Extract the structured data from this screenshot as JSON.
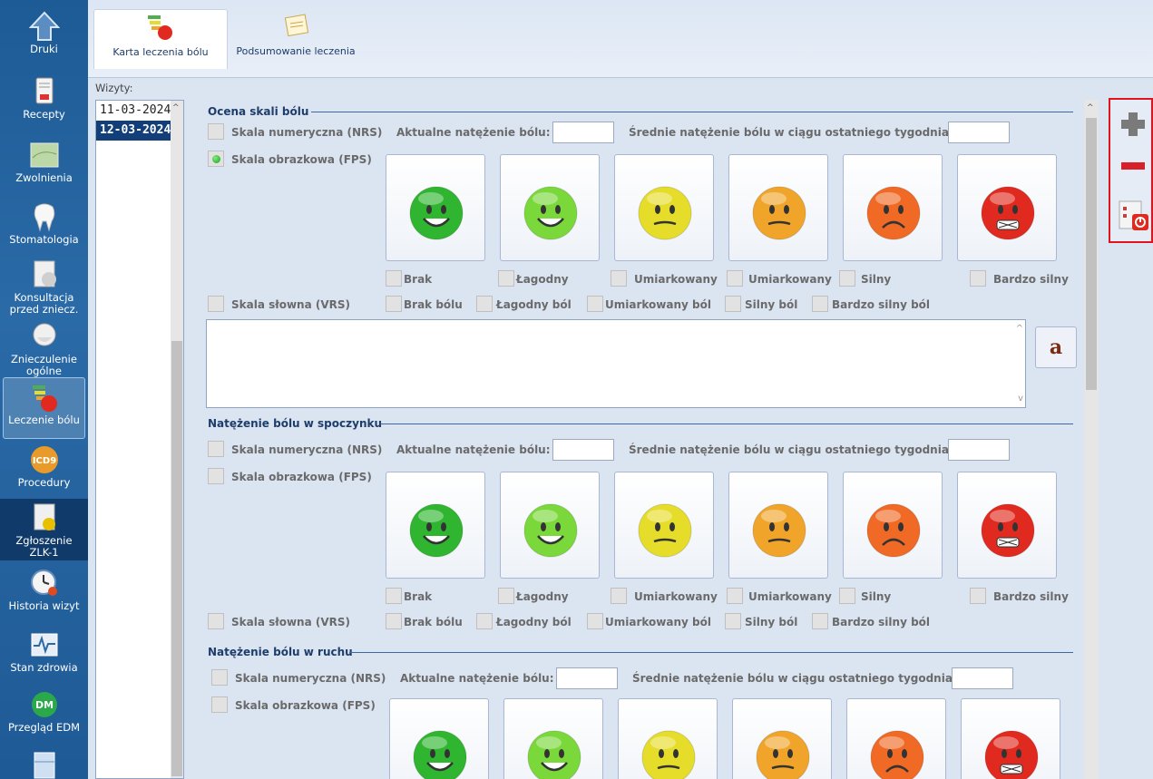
{
  "sidebar": {
    "items": [
      {
        "label": "Druki",
        "icon": "up-arrow-icon"
      },
      {
        "label": "Recepty",
        "icon": "prescription-icon"
      },
      {
        "label": "Zwolnienia",
        "icon": "map-icon"
      },
      {
        "label": "Stomatologia",
        "icon": "tooth-icon"
      },
      {
        "label": "Konsultacja przed zniecz.",
        "icon": "consultation-icon"
      },
      {
        "label": "Znieczulenie ogólne",
        "icon": "anesthesia-mask-icon"
      },
      {
        "label": "Leczenie bólu",
        "icon": "pain-scale-icon"
      },
      {
        "label": "Procedury",
        "icon": "icd9-icon"
      },
      {
        "label": "Zgłoszenie ZLK-1",
        "icon": "biohazard-report-icon"
      },
      {
        "label": "Historia wizyt",
        "icon": "clock-history-icon"
      },
      {
        "label": "Stan zdrowia",
        "icon": "health-chart-icon"
      },
      {
        "label": "Przegląd EDM",
        "icon": "edm-icon"
      }
    ]
  },
  "tabs": [
    {
      "label": "Karta leczenia bólu",
      "icon": "pain-scale-icon"
    },
    {
      "label": "Podsumowanie leczenia",
      "icon": "notes-icon"
    }
  ],
  "wizyty": {
    "label": "Wizyty:",
    "dates": [
      "11-03-2024",
      "12-03-2024"
    ]
  },
  "sections": [
    {
      "title": "Ocena skali bólu",
      "nrs": "Skala numeryczna (NRS)",
      "current": "Aktualne natężenie bólu:",
      "average": "Średnie natężenie bólu w ciągu ostatniego tygodnia:",
      "fps": "Skala obrazkowa (FPS)",
      "vrs": "Skala słowna (VRS)"
    },
    {
      "title": "Natężenie bólu w spoczynku",
      "nrs": "Skala numeryczna (NRS)",
      "current": "Aktualne natężenie bólu:",
      "average": "Średnie natężenie bólu w ciągu ostatniego tygodnia:",
      "fps": "Skala obrazkowa (FPS)",
      "vrs": "Skala słowna (VRS)"
    },
    {
      "title": "Natężenie bólu w ruchu",
      "nrs": "Skala numeryczna (NRS)",
      "current": "Aktualne natężenie bólu:",
      "average": "Średnie natężenie bólu w ciągu ostatniego tygodnia:",
      "fps": "Skala obrazkowa (FPS)"
    }
  ],
  "face_labels": [
    "Brak",
    "Łagodny",
    "Umiarkowany",
    "Umiarkowany",
    "Silny",
    "Bardzo silny"
  ],
  "vrs_labels": [
    "Brak bólu",
    "Łagodny ból",
    "Umiarkowany ból",
    "Silny ból",
    "Bardzo silny ból"
  ],
  "face_colors": [
    "#2fb52f",
    "#7ad83a",
    "#e6dd2a",
    "#f0a52a",
    "#f06a25",
    "#e02a20"
  ],
  "toolbar": {
    "icons": [
      "add-icon",
      "remove-icon",
      "close-document-icon"
    ]
  },
  "colors": {
    "sidebar": "#1d5b96",
    "selected_visit": "#123e7a",
    "highlight_border": "#e0141e"
  }
}
